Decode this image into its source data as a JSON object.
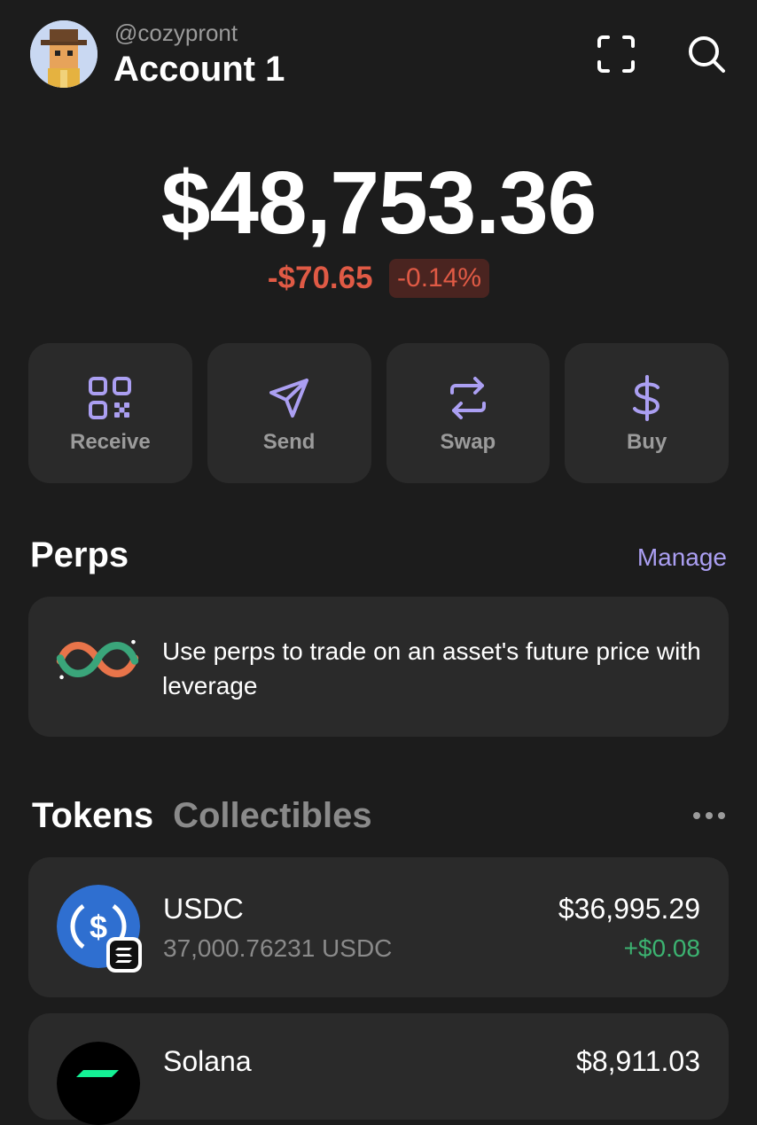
{
  "header": {
    "handle": "@cozypront",
    "account_name": "Account 1"
  },
  "balance": {
    "total": "$48,753.36",
    "change_value": "-$70.65",
    "change_percent": "-0.14%"
  },
  "actions": [
    {
      "label": "Receive",
      "icon": "qr-code-icon"
    },
    {
      "label": "Send",
      "icon": "send-icon"
    },
    {
      "label": "Swap",
      "icon": "swap-icon"
    },
    {
      "label": "Buy",
      "icon": "dollar-icon"
    }
  ],
  "perps": {
    "title": "Perps",
    "manage_label": "Manage",
    "description": "Use perps to trade on an asset's future price with leverage"
  },
  "tabs": {
    "active": "Tokens",
    "inactive": "Collectibles"
  },
  "tokens": [
    {
      "name": "USDC",
      "amount": "37,000.76231 USDC",
      "value": "$36,995.29",
      "change": "+$0.08"
    },
    {
      "name": "Solana",
      "amount": "",
      "value": "$8,911.03",
      "change": ""
    }
  ],
  "colors": {
    "background": "#1c1c1c",
    "card": "#2a2a2a",
    "accent": "#ab9ff2",
    "negative": "#e05a45",
    "positive": "#3cb371"
  }
}
